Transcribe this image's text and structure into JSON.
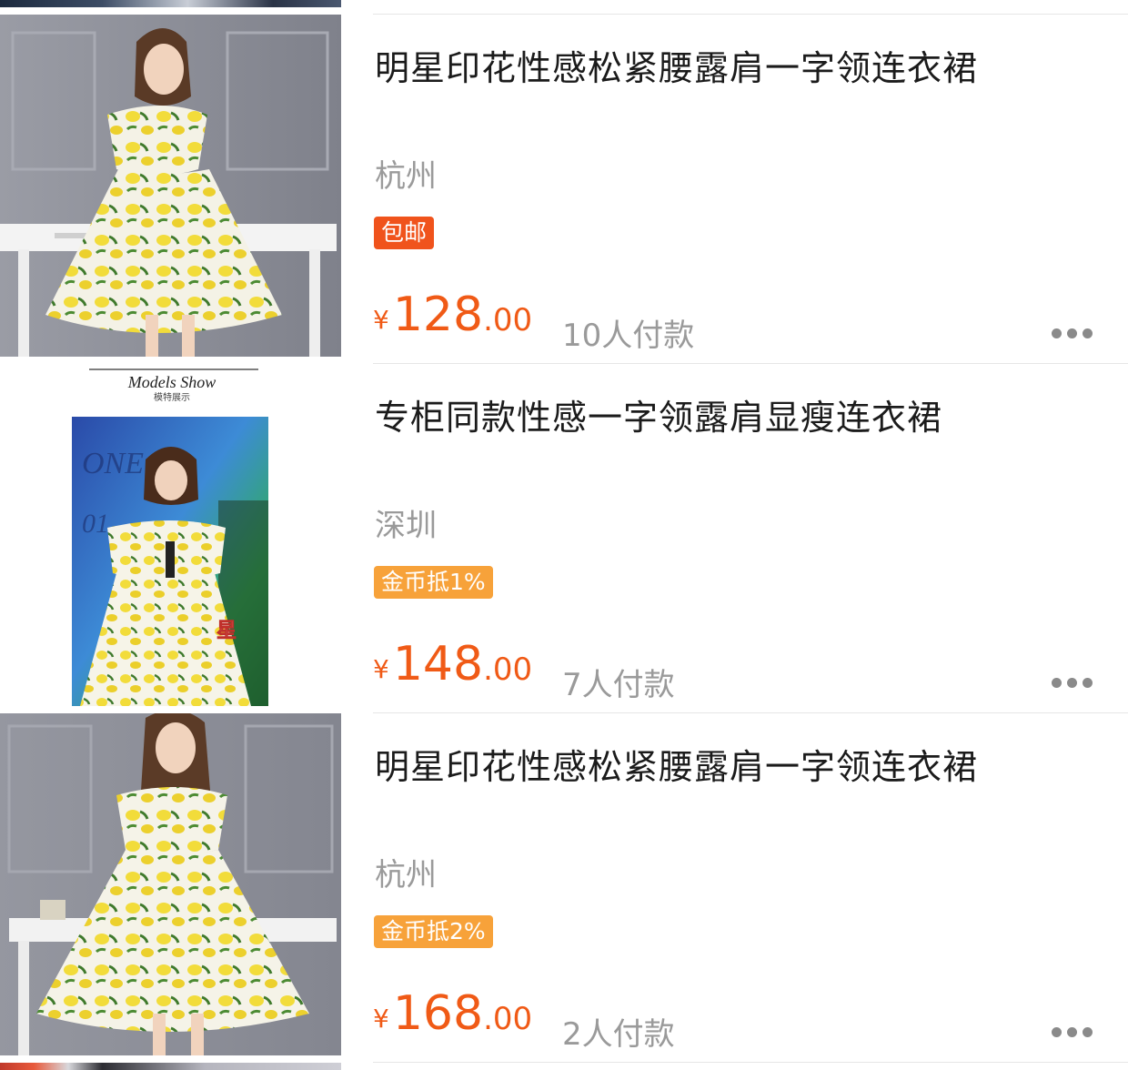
{
  "products": [
    {
      "title": "明星印花性感松紧腰露肩一字领连衣裙",
      "location": "杭州",
      "tag": "包邮",
      "tag_color": "#f0531c",
      "currency": "¥",
      "price_int": "128",
      "price_dec": ".00",
      "paid": "10人付款",
      "thumb_desc": "model-in-lemon-print-dress-gray-room"
    },
    {
      "title": "专柜同款性感一字领露肩显瘦连衣裙",
      "location": "深圳",
      "tag": "金币抵1%",
      "tag_color": "#f7a23a",
      "currency": "¥",
      "price_int": "148",
      "price_dec": ".00",
      "paid": "7人付款",
      "thumb_desc": "models-show-poster",
      "poster_title": "Models Show",
      "poster_subtitle": "模特展示"
    },
    {
      "title": "明星印花性感松紧腰露肩一字领连衣裙",
      "location": "杭州",
      "tag": "金币抵2%",
      "tag_color": "#f7a23a",
      "currency": "¥",
      "price_int": "168",
      "price_dec": ".00",
      "paid": "2人付款",
      "thumb_desc": "model-holding-lemon-print-dress-skirt"
    }
  ],
  "icons": {
    "more": "more-dots-icon"
  }
}
